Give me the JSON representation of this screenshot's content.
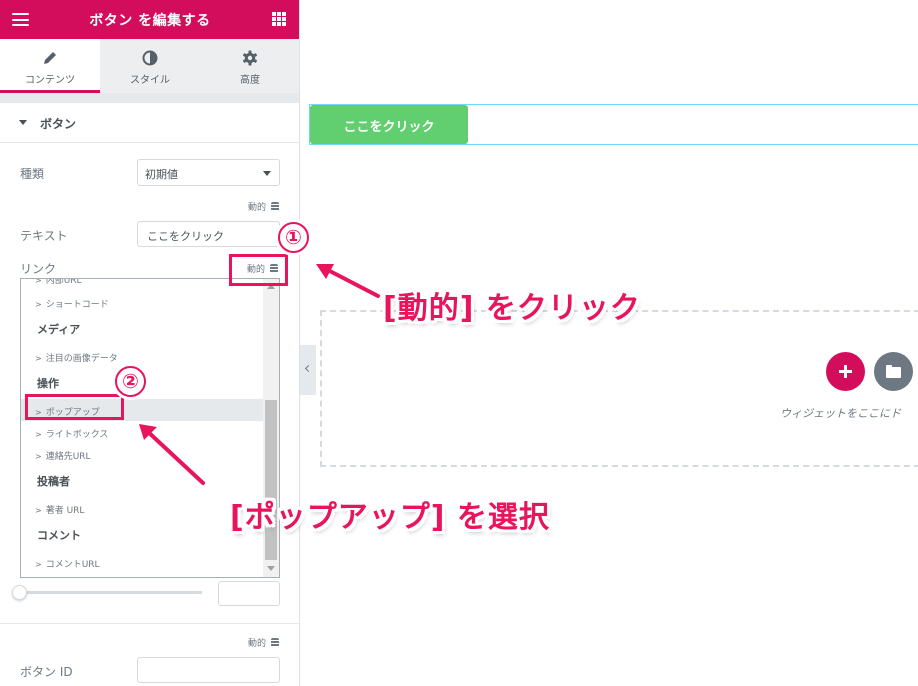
{
  "panel": {
    "title": "ボタン を編集する",
    "tabs": [
      {
        "label": "コンテンツ"
      },
      {
        "label": "スタイル"
      },
      {
        "label": "高度"
      }
    ],
    "section_title": "ボタン",
    "type_label": "種類",
    "type_value": "初期値",
    "dynamic_label": "動的",
    "text_label": "テキスト",
    "text_value": "ここをクリック",
    "link_label": "リンク",
    "button_id_label": "ボタン ID"
  },
  "dynamic_list": {
    "cutoff_item": "内部URL",
    "shortcode": "ショートコード",
    "media_group": "メディア",
    "featured_image": "注目の画像データ",
    "action_group": "操作",
    "popup": "ポップアップ",
    "lightbox": "ライトボックス",
    "contact_url": "連絡先URL",
    "author_group": "投稿者",
    "author_url": "著者 URL",
    "comment_group": "コメント",
    "comment_url": "コメントURL",
    "item_prefix": ">"
  },
  "canvas": {
    "button_text": "ここをクリック",
    "drop_hint": "ウィジェットをここにド"
  },
  "annotations": {
    "step1_number": "①",
    "step2_number": "②",
    "callout_1": "[動的] をクリック",
    "callout_2": "[ポップアップ] を選択"
  },
  "colors": {
    "brand": "#d30c5c",
    "annotation": "#e8155d",
    "canvas_button": "#61ce70"
  }
}
